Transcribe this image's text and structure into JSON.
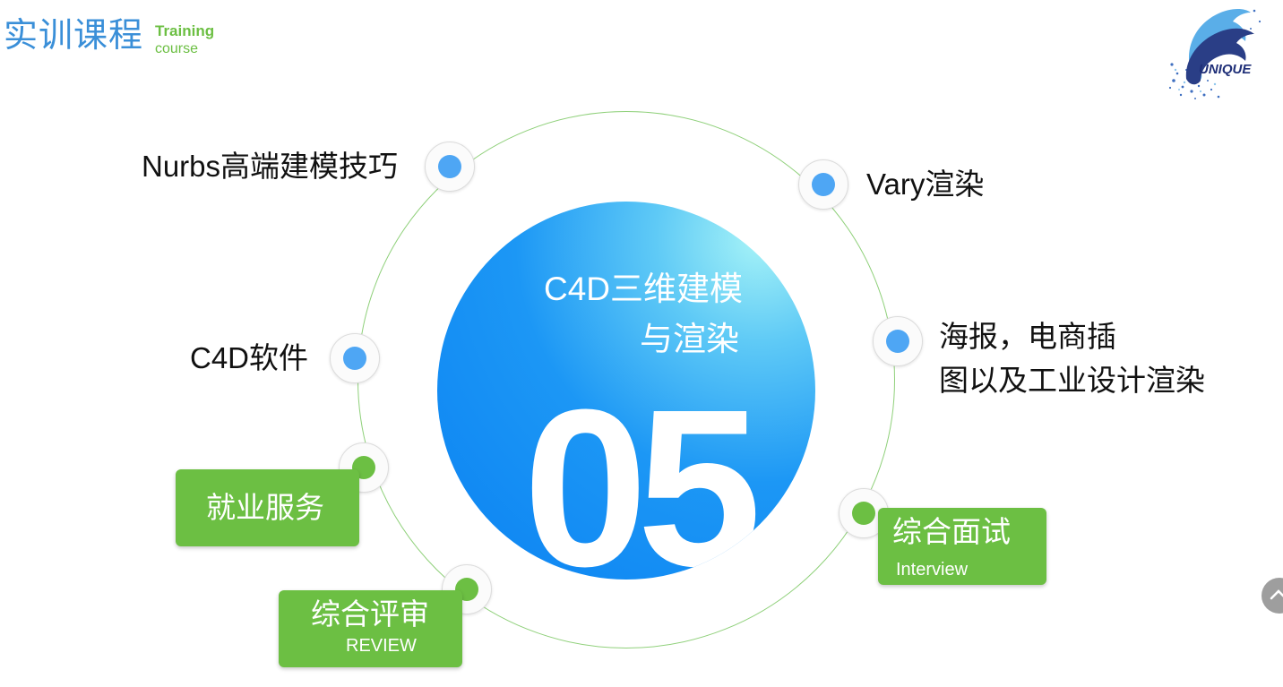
{
  "header": {
    "title_cn": "实训课程",
    "title_en_line1": "Training",
    "title_en_line2": "course"
  },
  "logo": {
    "text": "UNIQUE",
    "icon": "dolphin-logo-icon"
  },
  "center": {
    "title_line1": "C4D三维建模",
    "title_line2": "与渲染",
    "number": "05"
  },
  "items": {
    "nurbs": "Nurbs高端建模技巧",
    "vary": "Vary渲染",
    "c4d": "C4D软件",
    "poster_line1": "海报，电商插",
    "poster_line2": "图以及工业设计渲染"
  },
  "boxes": {
    "employment": {
      "label": "就业服务"
    },
    "review": {
      "label": "综合评审",
      "sub": "REVIEW"
    },
    "interview": {
      "label": "综合面试",
      "sub": "Interview"
    }
  },
  "colors": {
    "accent_blue": "#0b82f2",
    "accent_green": "#6cbf43",
    "header_blue": "#3a8fd8"
  },
  "controls": {
    "scroll_top_icon": "chevron-up-icon"
  }
}
